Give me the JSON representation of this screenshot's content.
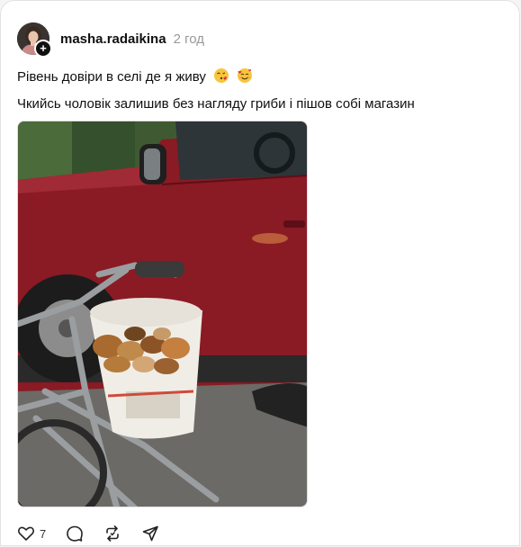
{
  "post": {
    "username": "masha.radaikina",
    "timestamp": "2 год",
    "text_line1": "Рівень довіри в селі де я живу",
    "text_line2": "Чкийсь чоловік залишив без нагляду гриби і пішов собі магазин",
    "emojis": [
      "face-blowing-kiss-icon",
      "smiling-face-with-hearts-icon"
    ],
    "image_alt_subject": "bicycle with bucket of mushrooms next to red car"
  },
  "actions": {
    "like_count": "7",
    "icons": [
      "heart-icon",
      "comment-icon",
      "repost-icon",
      "share-icon"
    ]
  },
  "colors": {
    "text": "#101010",
    "muted": "#999999",
    "border": "#e2e2e2",
    "car_red": "#8a1a24"
  }
}
